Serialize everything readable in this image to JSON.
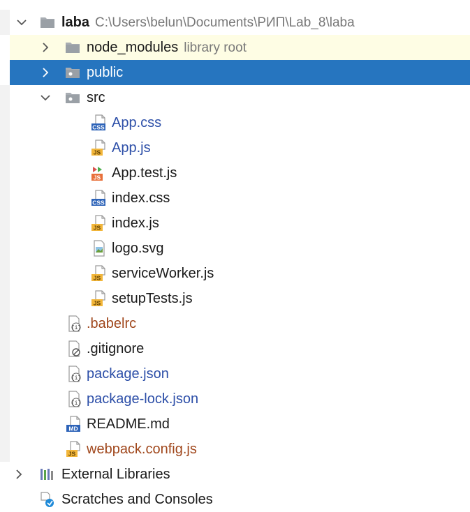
{
  "colors": {
    "selection": "#2675bf",
    "ignored_row": "#fefde4",
    "blue_text": "#2d4fa8",
    "brown_text": "#a0471c",
    "path_gray": "#787878"
  },
  "root": {
    "name": "laba",
    "path": "C:\\Users\\belun\\Documents\\РИП\\Lab_8\\laba"
  },
  "items": [
    {
      "name": "node_modules",
      "hint": "library root",
      "icon": "folder-icon"
    },
    {
      "name": "public",
      "icon": "folder-icon"
    },
    {
      "name": "src",
      "icon": "folder-icon"
    },
    {
      "name": "App.css",
      "icon": "css-file-icon"
    },
    {
      "name": "App.js",
      "icon": "js-file-icon"
    },
    {
      "name": "App.test.js",
      "icon": "js-test-file-icon"
    },
    {
      "name": "index.css",
      "icon": "css-file-icon"
    },
    {
      "name": "index.js",
      "icon": "js-file-icon"
    },
    {
      "name": "logo.svg",
      "icon": "image-file-icon"
    },
    {
      "name": "serviceWorker.js",
      "icon": "js-file-icon"
    },
    {
      "name": "setupTests.js",
      "icon": "js-file-icon"
    },
    {
      "name": ".babelrc",
      "icon": "json-file-icon"
    },
    {
      "name": ".gitignore",
      "icon": "ignore-file-icon"
    },
    {
      "name": "package.json",
      "icon": "json-file-icon"
    },
    {
      "name": "package-lock.json",
      "icon": "json-file-icon"
    },
    {
      "name": "README.md",
      "icon": "markdown-file-icon"
    },
    {
      "name": "webpack.config.js",
      "icon": "js-file-icon"
    }
  ],
  "footer": {
    "external_libraries": "External Libraries",
    "scratches": "Scratches and Consoles"
  }
}
